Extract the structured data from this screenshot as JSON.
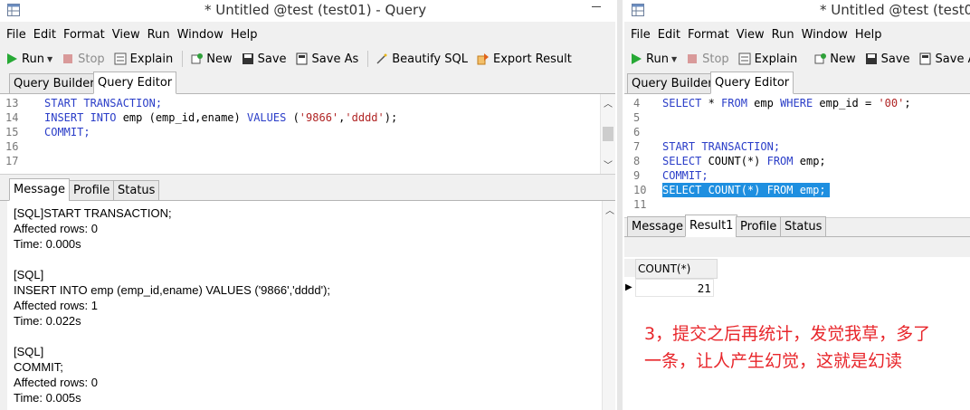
{
  "left": {
    "title": "* Untitled @test (test01) - Query",
    "menu": [
      "File",
      "Edit",
      "Format",
      "View",
      "Run",
      "Window",
      "Help"
    ],
    "toolbar": {
      "run": "Run",
      "stop": "Stop",
      "explain": "Explain",
      "new": "New",
      "save": "Save",
      "save_as": "Save As",
      "beautify": "Beautify SQL",
      "export": "Export Result"
    },
    "editor_tabs": [
      "Query Builder",
      "Query Editor"
    ],
    "code_lines": [
      {
        "num": "13",
        "text": "START TRANSACTION;"
      },
      {
        "num": "14",
        "text": "INSERT INTO emp (emp_id,ename) VALUES ('9866','dddd');"
      },
      {
        "num": "15",
        "text": "COMMIT;"
      },
      {
        "num": "16",
        "text": ""
      },
      {
        "num": "17",
        "text": ""
      }
    ],
    "result_tabs": [
      "Message",
      "Profile",
      "Status"
    ],
    "messages": [
      "[SQL]START TRANSACTION;",
      "Affected rows: 0",
      "Time: 0.000s",
      "",
      "[SQL]",
      "INSERT INTO emp (emp_id,ename) VALUES ('9866','dddd');",
      "Affected rows: 1",
      "Time: 0.022s",
      "",
      "[SQL]",
      "COMMIT;",
      "Affected rows: 0",
      "Time: 0.005s"
    ]
  },
  "right": {
    "title": "* Untitled @test (test0",
    "menu": [
      "File",
      "Edit",
      "Format",
      "View",
      "Run",
      "Window",
      "Help"
    ],
    "toolbar": {
      "run": "Run",
      "stop": "Stop",
      "explain": "Explain",
      "new": "New",
      "save": "Save",
      "save_as": "Save As"
    },
    "editor_tabs": [
      "Query Builder",
      "Query Editor"
    ],
    "code_lines": [
      {
        "num": "4",
        "text": "SELECT * FROM emp WHERE emp_id = '00';"
      },
      {
        "num": "5",
        "text": ""
      },
      {
        "num": "6",
        "text": ""
      },
      {
        "num": "7",
        "text": "START TRANSACTION;"
      },
      {
        "num": "8",
        "text": "SELECT COUNT(*) FROM emp;"
      },
      {
        "num": "9",
        "text": "COMMIT;"
      },
      {
        "num": "10",
        "text": "SELECT COUNT(*) FROM emp;"
      },
      {
        "num": "11",
        "text": ""
      }
    ],
    "result_tabs": [
      "Message",
      "Result1",
      "Profile",
      "Status"
    ],
    "grid": {
      "header": "COUNT(*)",
      "value": "21"
    },
    "annotation_line1": "3，提交之后再统计，发觉我草，多了",
    "annotation_line2": "一条，让人产生幻觉，这就是幻读"
  },
  "colors": {
    "keyword": "#2a3dc8",
    "string": "#b02424",
    "selection": "#1e8fe0",
    "annotation": "#e8262b"
  }
}
